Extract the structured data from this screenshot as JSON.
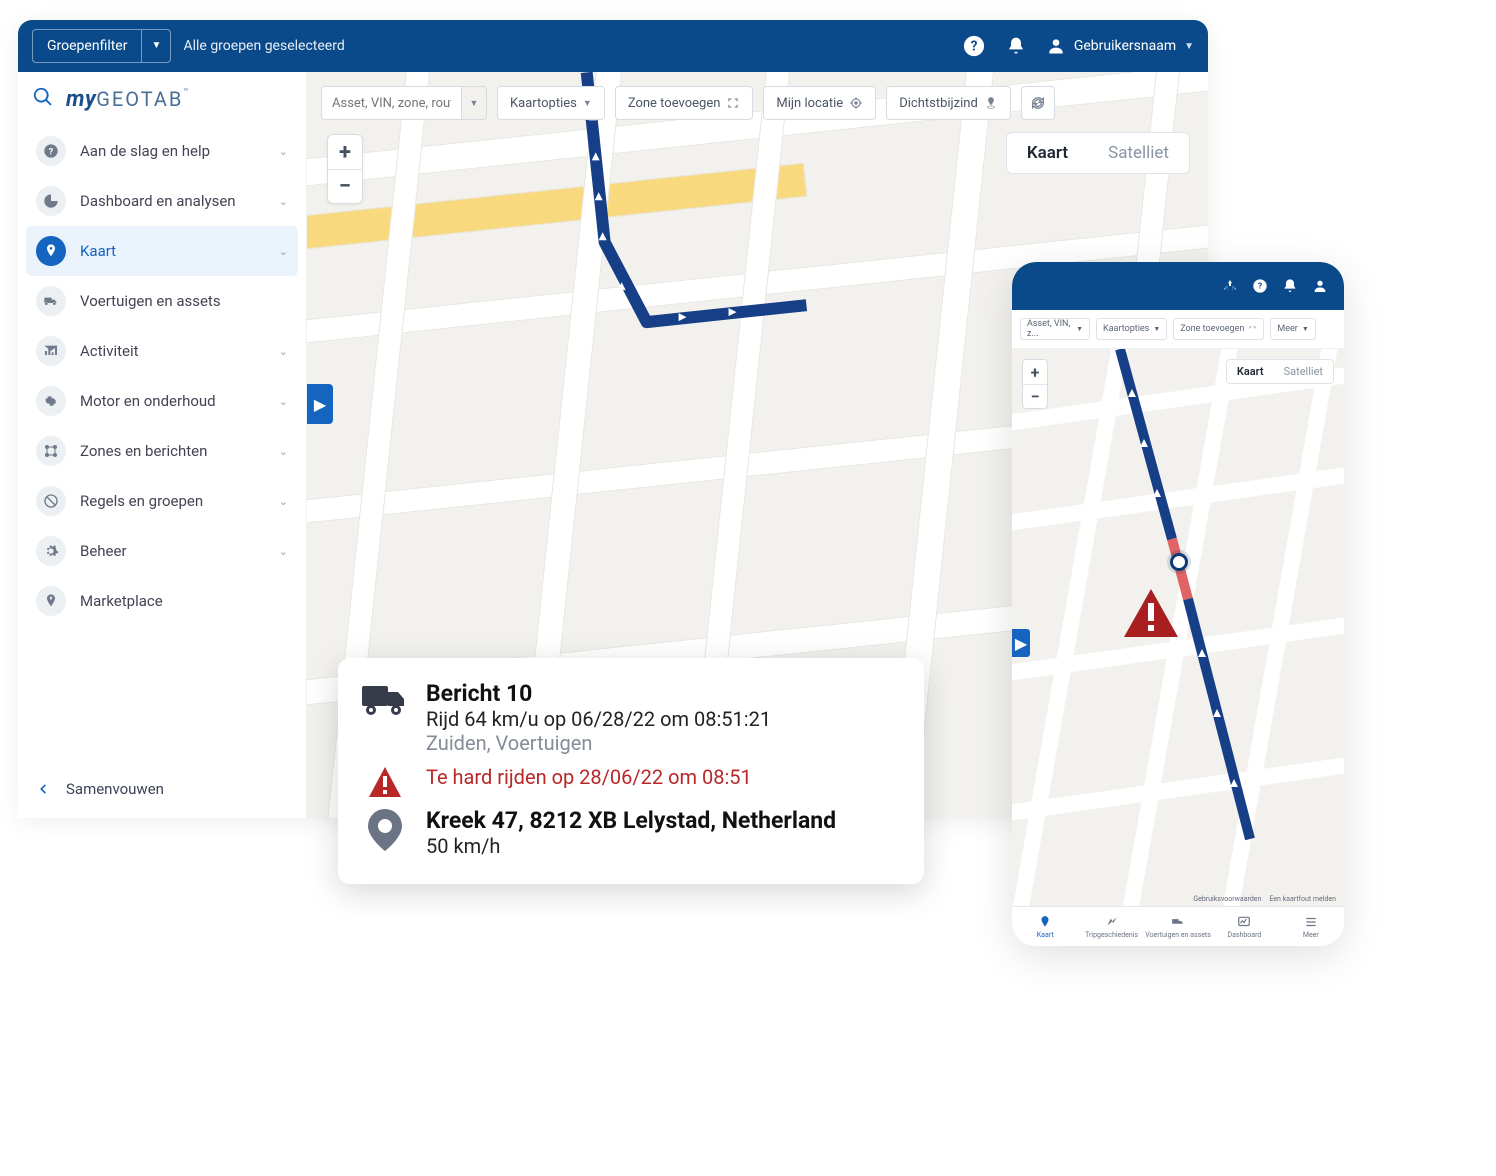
{
  "topbar": {
    "group_filter_label": "Groepenfilter",
    "groups_selected": "Alle groepen geselecteerd",
    "username": "Gebruikersnaam"
  },
  "logo": {
    "my": "my",
    "geotab": "GEOTAB",
    "tm": "™"
  },
  "nav": [
    {
      "label": "Aan de slag en help",
      "chev": true
    },
    {
      "label": "Dashboard en analysen",
      "chev": true
    },
    {
      "label": "Kaart",
      "chev": true
    },
    {
      "label": "Voertuigen en assets",
      "chev": false
    },
    {
      "label": "Activiteit",
      "chev": true
    },
    {
      "label": "Motor en onderhoud",
      "chev": true
    },
    {
      "label": "Zones en berichten",
      "chev": true
    },
    {
      "label": "Regels en groepen",
      "chev": true
    },
    {
      "label": "Beheer",
      "chev": true
    },
    {
      "label": "Marketplace",
      "chev": false
    }
  ],
  "collapse_label": "Samenvouwen",
  "map_toolbar": {
    "search_placeholder": "Asset, VIN, zone, rout...",
    "options": "Kaartopties",
    "add_zone": "Zone toevoegen",
    "my_location": "Mijn locatie",
    "nearest": "Dichtstbijzind"
  },
  "maptype": {
    "map": "Kaart",
    "sat": "Satelliet"
  },
  "map_error": "Een kaartfout melden",
  "phone": {
    "search_placeholder": "Asset, VIN, z...",
    "options": "Kaartopties",
    "add_zone": "Zone toevoegen",
    "more": "Meer",
    "maptype_map": "Kaart",
    "maptype_sat": "Satelliet",
    "terms": "Gebruiksvoorwaarden",
    "map_error": "Een kaartfout melden",
    "nav": [
      "Kaart",
      "Tripgeschiedenis",
      "Voertuigen en assets",
      "Dashboard",
      "Meer"
    ]
  },
  "info": {
    "title": "Bericht 10",
    "line1": "Rijd 64 km/u op 06/28/22 om 08:51:21",
    "line2": "Zuiden, Voertuigen",
    "alert": "Te hard rijden op 28/06/22 om 08:51",
    "address": "Kreek 47, 8212 XB Lelystad, Netherland",
    "speed": "50 km/h"
  }
}
